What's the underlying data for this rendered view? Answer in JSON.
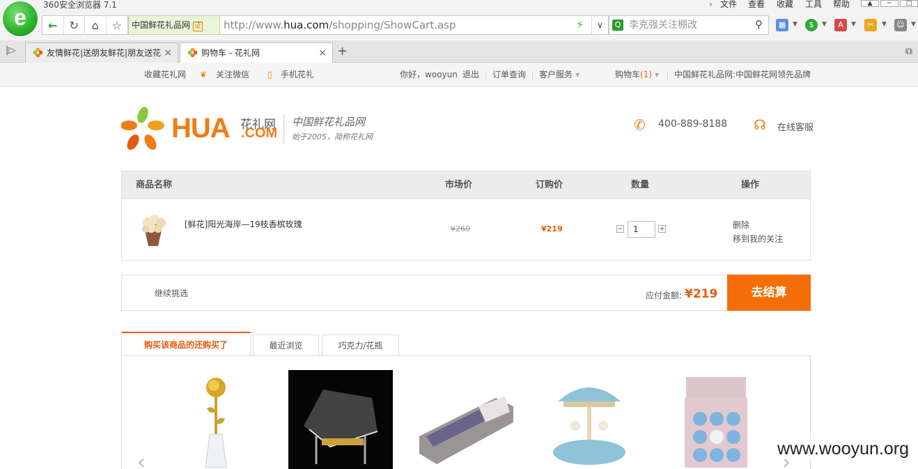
{
  "browser": {
    "title": "360安全浏览器 7.1",
    "menus": [
      "文件",
      "查看",
      "收藏",
      "工具",
      "帮助"
    ],
    "address": {
      "site_name": "中国鲜花礼品网",
      "cert_badge": "证",
      "url_prefix": "http://www.",
      "url_host": "hua.com",
      "url_path": "/shopping/ShowCart.asp"
    },
    "search_placeholder": "李克强关注棚改",
    "tabs": [
      {
        "label": "友情鲜花|送朋友鲜花|朋友送花",
        "active": false
      },
      {
        "label": "购物车 - 花礼网",
        "active": true
      }
    ]
  },
  "site_topbar": {
    "bookmark": "收藏花礼网",
    "wechat": "关注微信",
    "mobile": "手机花礼",
    "greeting": "你好，wooyun",
    "logout": "退出",
    "orders": "订单查询",
    "service": "客户服务",
    "cart_label": "购物车",
    "cart_count": "(1)",
    "slogan": "中国鲜花礼品网:中国鲜花网领先品牌"
  },
  "header": {
    "logo_hua": "HUA",
    "logo_com": ".COM",
    "logo_cn": "花礼网",
    "slogan_main": "中国鲜花礼品网",
    "slogan_sub": "始于2005，简称花礼网",
    "phone": "400-889-8188",
    "online_service": "在线客服"
  },
  "cart": {
    "columns": [
      "商品名称",
      "市场价",
      "订购价",
      "数量",
      "操作"
    ],
    "items": [
      {
        "name": "[鲜花]阳光海岸—19枝香槟玫瑰",
        "market_price": "¥260",
        "order_price": "¥219",
        "quantity": "1",
        "action_delete": "删除",
        "action_move": "移到我的关注"
      }
    ]
  },
  "checkout": {
    "continue": "继续挑选",
    "total_label": "应付金额:",
    "total_value": "¥219",
    "button": "去结算"
  },
  "recommend": {
    "tabs": [
      "购买该商品的还购买了",
      "最近浏览",
      "巧克力/花瓶"
    ]
  },
  "watermark": "www.wooyun.org",
  "colors": {
    "accent_orange": "#f56d06",
    "price_orange": "#e85a0e",
    "browser_green": "#2fb42d"
  }
}
